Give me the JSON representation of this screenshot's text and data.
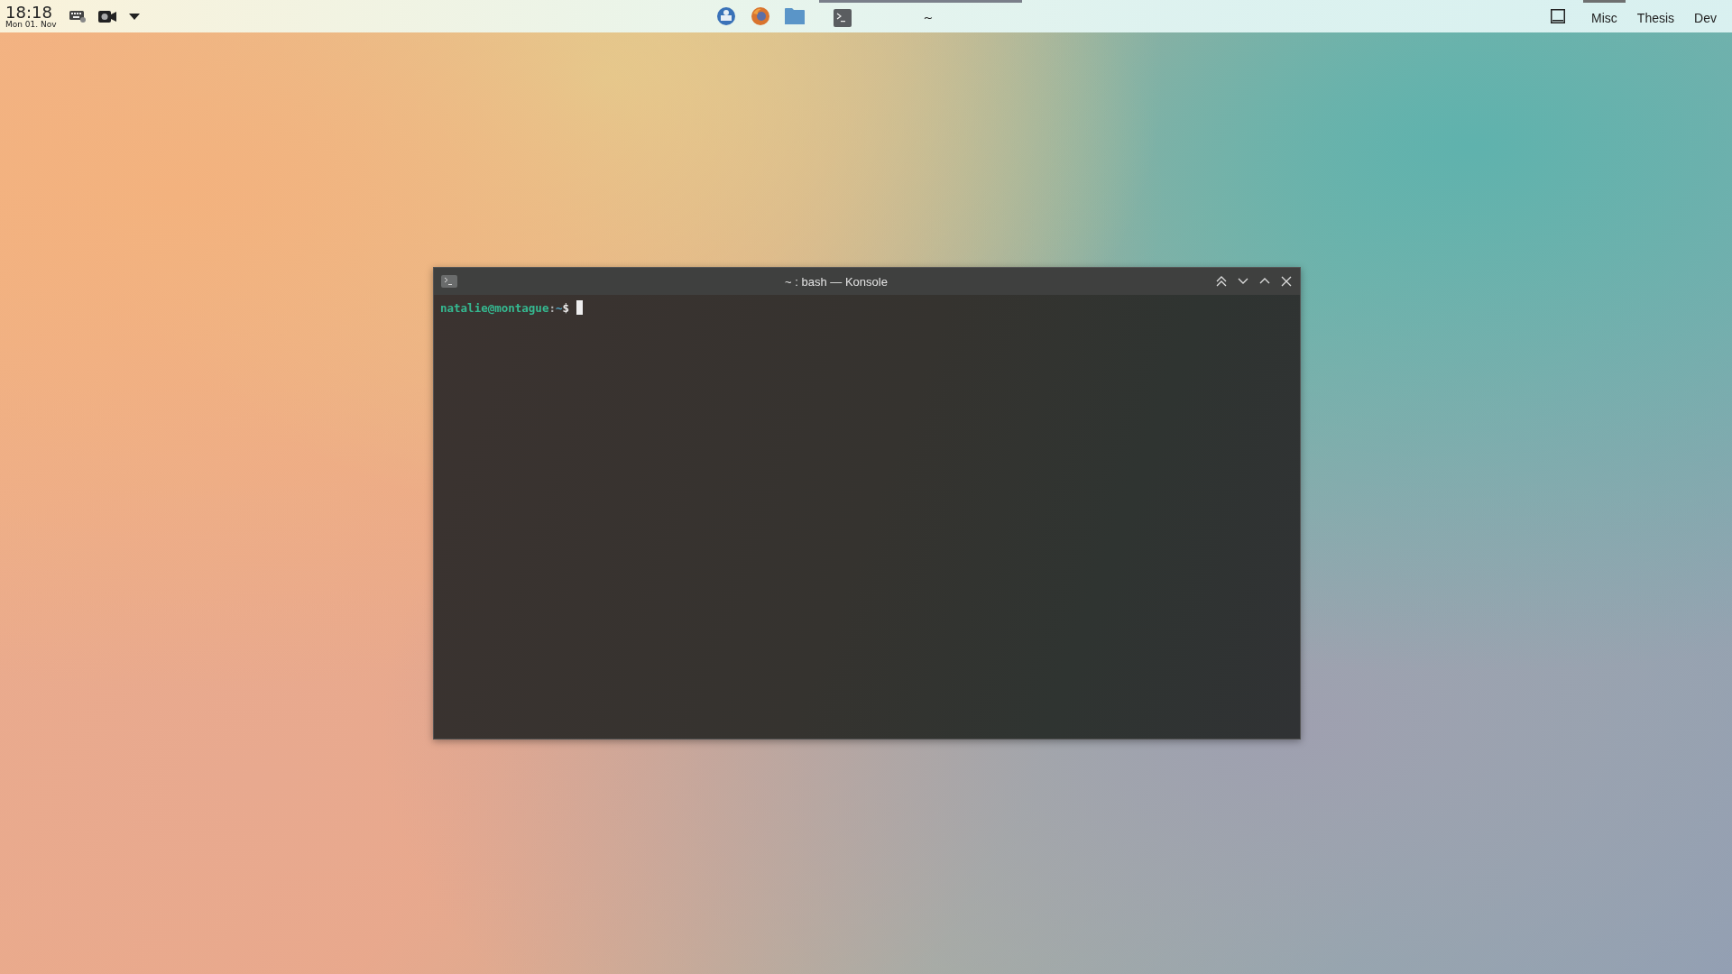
{
  "panel": {
    "clock": {
      "time": "18:18",
      "date": "Mon 01. Nov"
    },
    "tray": [
      {
        "kind": "keyboard"
      },
      {
        "kind": "camera"
      },
      {
        "kind": "dropdown"
      }
    ],
    "launchers": [
      {
        "kind": "mail"
      },
      {
        "kind": "browser"
      },
      {
        "kind": "folder"
      }
    ],
    "tasks": [
      {
        "kind": "terminal",
        "title": "~",
        "active": true
      }
    ],
    "desktops": [
      {
        "label": "Misc",
        "selected": true
      },
      {
        "label": "Thesis",
        "selected": false
      },
      {
        "label": "Dev",
        "selected": false
      }
    ]
  },
  "window": {
    "title": "~ : bash — Konsole",
    "active": true,
    "prompt": [
      {
        "kind": "userhost",
        "text": "natalie@montague"
      },
      {
        "kind": "sep",
        "text": ":"
      },
      {
        "kind": "path",
        "text": "~"
      },
      {
        "kind": "sign",
        "text": "$"
      }
    ]
  }
}
